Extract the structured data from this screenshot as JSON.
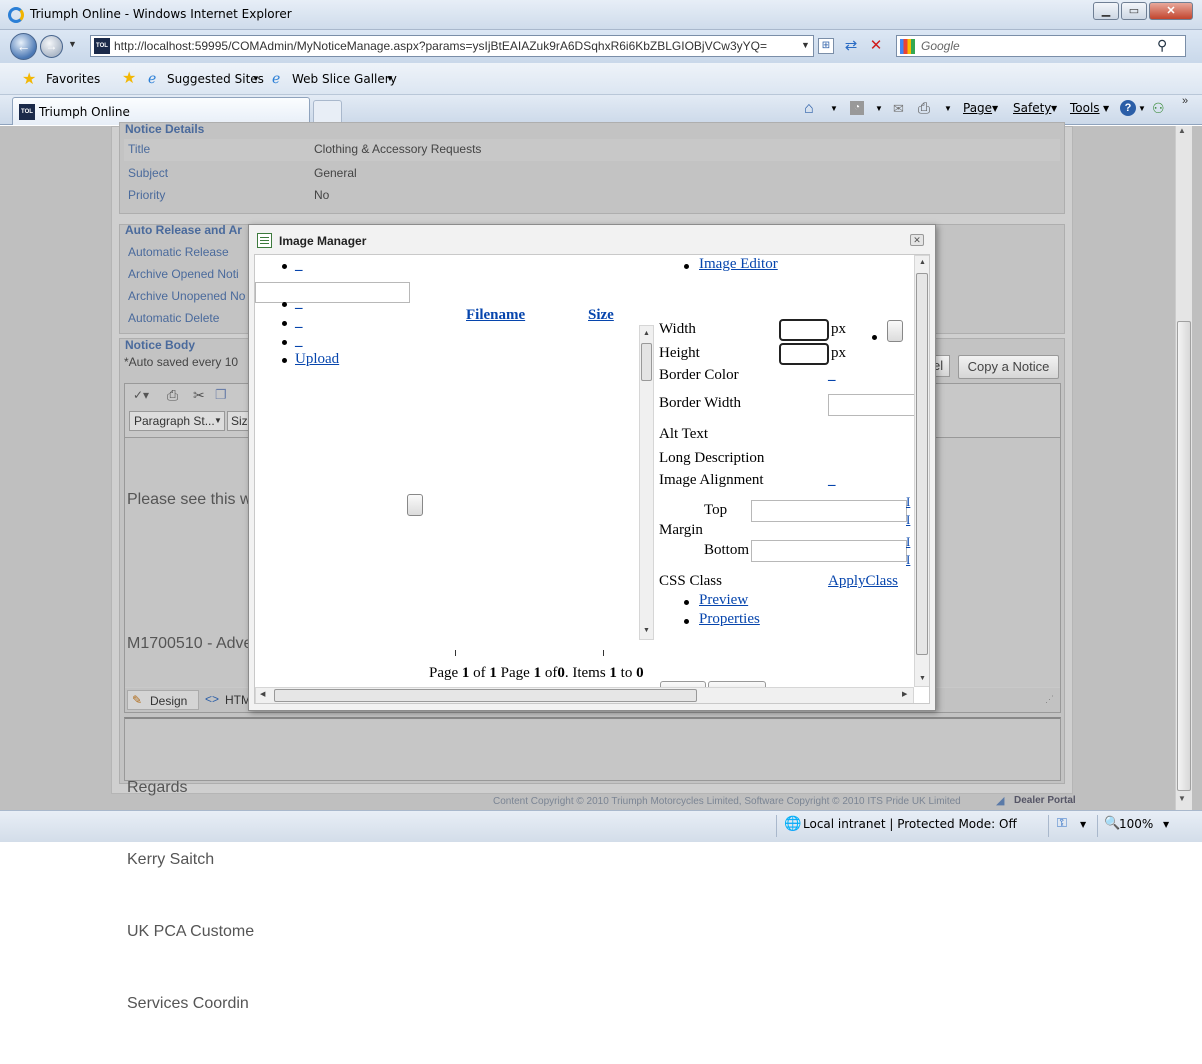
{
  "window": {
    "title": "Triumph Online - Windows Internet Explorer",
    "address": "http://localhost:59995/COMAdmin/MyNoticeManage.aspx?params=ysIjBtEAIAZuk9rA6DSqhxR6i6KbZBLGIOBjVCw3yYQ=",
    "search_placeholder": "Google",
    "favorites": "Favorites",
    "suggested_sites": "Suggested Sites",
    "web_slice_gallery": "Web Slice Gallery",
    "tab_title": "Triumph Online",
    "tab_icon_text": "TOL",
    "menu": {
      "page": "Page",
      "safety": "Safety",
      "tools": "Tools"
    }
  },
  "notice": {
    "details_heading": "Notice Details",
    "rows": [
      {
        "label": "Title",
        "value": "Clothing & Accessory Requests"
      },
      {
        "label": "Subject",
        "value": "General"
      },
      {
        "label": "Priority",
        "value": "No"
      }
    ],
    "auto_heading": "Auto Release and Ar",
    "auto_rows": [
      "Automatic Release",
      "Archive Opened Noti",
      "Archive Unopened No",
      "Automatic Delete"
    ],
    "body_heading": "Notice Body",
    "autosave": "*Auto saved every 10",
    "copy_button": "Copy a Notice",
    "partial_button": "el",
    "paragraph_style": "Paragraph St...",
    "size_label": "Size",
    "body_lines": [
      "Please see this w",
      "",
      "M1700510 - Adve",
      "",
      "Regards",
      "Kerry Saitch",
      "UK PCA Custome",
      "Services Coordin"
    ],
    "design_tab": "Design",
    "html_tab": "HTM"
  },
  "modal": {
    "title": "Image Manager",
    "image_editor": "Image Editor",
    "underscore": "_",
    "upload": "Upload",
    "col_filename": "Filename",
    "col_size": "Size",
    "props": {
      "width": "Width",
      "height": "Height",
      "px": "px",
      "border_color": "Border Color",
      "border_width": "Border Width",
      "alt_text": "Alt Text",
      "long_description": "Long Description",
      "image_alignment": "Image Alignment",
      "margin": "Margin",
      "top": "Top",
      "bottom": "Bottom",
      "css_class": "CSS Class",
      "apply_class": "ApplyClass",
      "preview": "Preview",
      "properties": "Properties",
      "side_l": "I",
      "side_i": "I"
    },
    "pager": {
      "page": "Page",
      "one": "1",
      "of": "of",
      "zero": "0",
      "items": "Items",
      "to": "to",
      "dot": "."
    }
  },
  "footer": {
    "copyright": "Content Copyright © 2010 Triumph Motorcycles Limited, Software Copyright © 2010 ITS Pride UK Limited",
    "dealer_portal": "Dealer Portal"
  },
  "status": {
    "zone": "Local intranet | Protected Mode: Off",
    "zoom": "100%"
  }
}
